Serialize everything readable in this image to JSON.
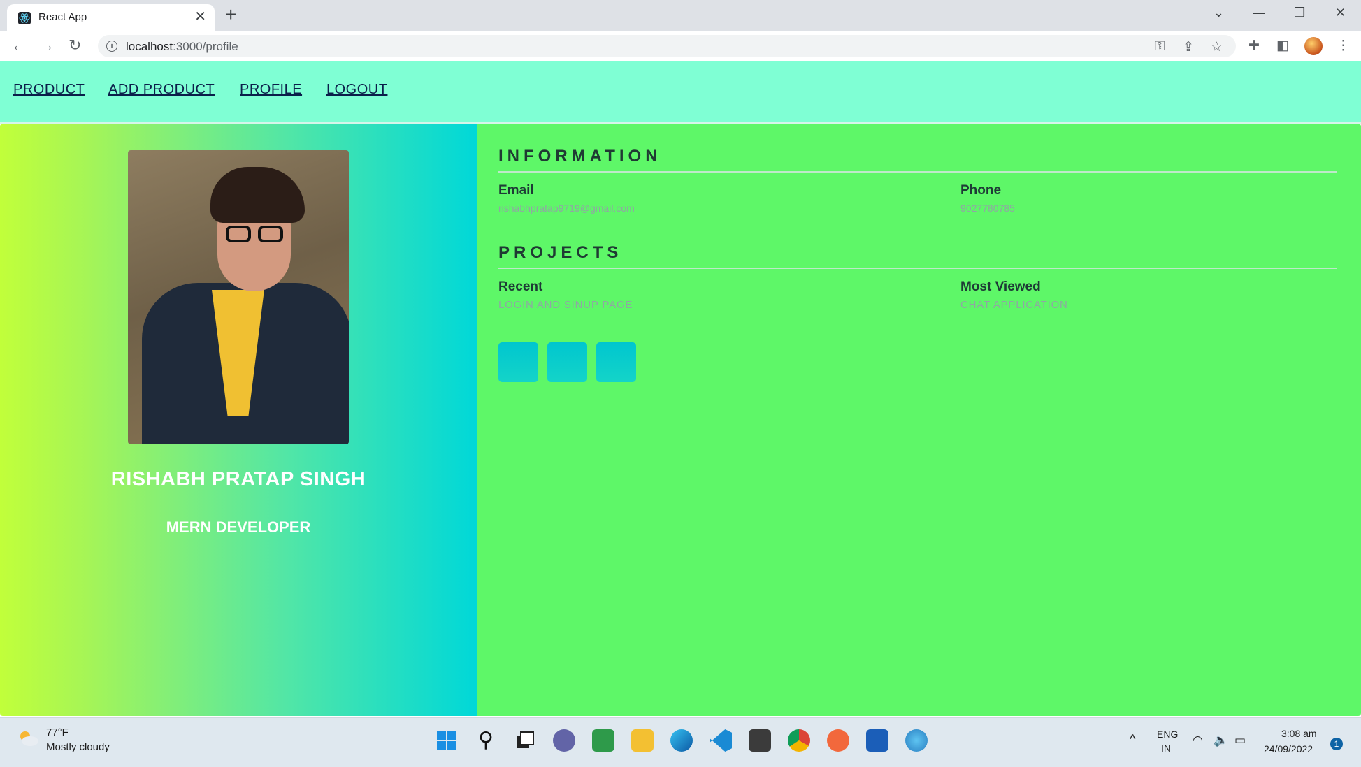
{
  "browser": {
    "tab_title": "React App",
    "tab_close": "✕",
    "new_tab": "+",
    "url_host": "localhost",
    "url_path": ":3000/profile",
    "icons": [
      "back-icon",
      "forward-icon",
      "reload-icon",
      "info-icon",
      "key-icon",
      "share-icon",
      "star-icon",
      "extensions-icon",
      "sidepanel-icon",
      "profile-avatar",
      "menu-icon"
    ]
  },
  "nav": {
    "items": [
      "PRODUCT",
      "ADD PRODUCT",
      "PROFILE",
      "LOGOUT"
    ]
  },
  "profile": {
    "name": "RISHABH PRATAP SINGH",
    "role": "MERN DEVELOPER"
  },
  "information": {
    "title": "INFORMATION",
    "email_label": "Email",
    "email_value": "rishabhpratap9719@gmail.com",
    "phone_label": "Phone",
    "phone_value": "9027780785"
  },
  "projects": {
    "title": "PROJECTS",
    "recent_label": "Recent",
    "recent_value": "LOGIN AND SINUP PAGE",
    "most_viewed_label": "Most Viewed",
    "most_viewed_value": "CHAT APPLICATION"
  },
  "taskbar": {
    "temperature": "77°F",
    "weather": "Mostly cloudy",
    "lang_top": "ENG",
    "lang_bottom": "IN",
    "time": "3:08 am",
    "date": "24/09/2022",
    "notifications": "1"
  },
  "colors": {
    "nav_bg": "#7fffd4",
    "right_panel": "#5ef768",
    "left_gradient_start": "#c1ff3a",
    "left_gradient_end": "#00d8d8"
  }
}
